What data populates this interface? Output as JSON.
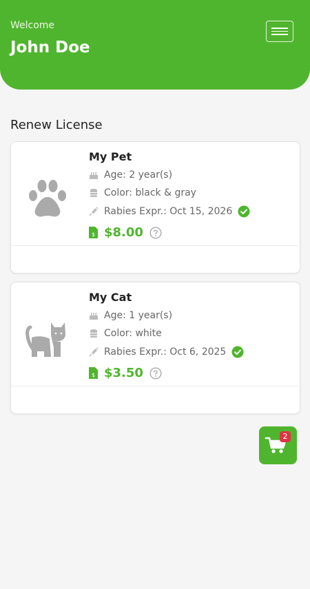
{
  "header": {
    "welcome": "Welcome",
    "username": "John Doe"
  },
  "section_title": "Renew License",
  "pets": [
    {
      "name": "My Pet",
      "image_icon": "paw-icon",
      "age": "Age: 2 year(s)",
      "color": "Color: black & gray",
      "rabies": "Rabies Expr.: Oct 15, 2026",
      "price": "$8.00"
    },
    {
      "name": "My Cat",
      "image_icon": "cat-icon",
      "age": "Age: 1 year(s)",
      "color": "Color: white",
      "rabies": "Rabies Expr.: Oct 6, 2025",
      "price": "$3.50"
    }
  ],
  "cart": {
    "count": "2"
  },
  "colors": {
    "brand": "#50b52e",
    "badge": "#dc3545",
    "icon_gray": "#aaaaaa"
  }
}
